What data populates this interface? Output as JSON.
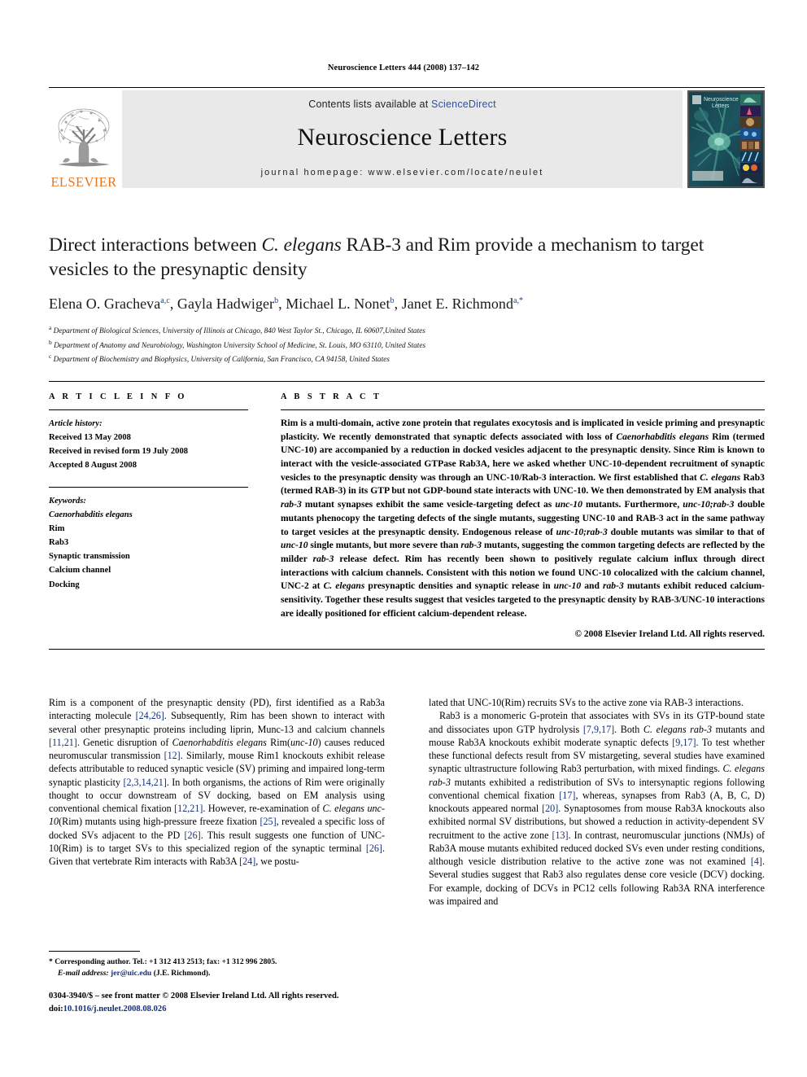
{
  "running_head": "Neuroscience Letters 444 (2008) 137–142",
  "masthead": {
    "contents_prefix": "Contents lists available at ",
    "sciencedirect": "ScienceDirect",
    "journal_name": "Neuroscience Letters",
    "homepage": "journal homepage: www.elsevier.com/locate/neulet",
    "publisher": "ELSEVIER",
    "cover_title_line1": "Neuroscience",
    "cover_title_line2": "Letters"
  },
  "article": {
    "title_part1": "Direct interactions between ",
    "title_italic": "C. elegans",
    "title_part2": " RAB-3 and Rim provide a mechanism to target vesicles to the presynaptic density",
    "authors": [
      {
        "name": "Elena O. Gracheva",
        "sup": "a,c",
        "sep": ", "
      },
      {
        "name": "Gayla Hadwiger",
        "sup": "b",
        "sep": ", "
      },
      {
        "name": "Michael L. Nonet",
        "sup": "b",
        "sep": ", "
      },
      {
        "name": "Janet E. Richmond",
        "sup": "a,*",
        "sep": ""
      }
    ],
    "affiliations": [
      {
        "marker": "a",
        "text": "Department of Biological Sciences, University of Illinois at Chicago, 840 West Taylor St., Chicago, IL 60607,United States"
      },
      {
        "marker": "b",
        "text": "Department of Anatomy and Neurobiology, Washington University School of Medicine, St. Louis, MO 63110, United States"
      },
      {
        "marker": "c",
        "text": "Department of Biochemistry and Biophysics, University of California, San Francisco, CA 94158, United States"
      }
    ]
  },
  "article_info": {
    "heading": "A R T I C L E   I N F O",
    "history_label": "Article history:",
    "history": [
      "Received 13 May 2008",
      "Received in revised form 19 July 2008",
      "Accepted 8 August 2008"
    ],
    "keywords_label": "Keywords:",
    "keywords": [
      "Caenorhabditis elegans",
      "Rim",
      "Rab3",
      "Synaptic transmission",
      "Calcium channel",
      "Docking"
    ],
    "keywords_italic_index": 0
  },
  "abstract": {
    "heading": "A B S T R A C T",
    "copyright": "© 2008 Elsevier Ireland Ltd. All rights reserved.",
    "paragraphs": [
      "Rim is a multi-domain, active zone protein that regulates exocytosis and is implicated in vesicle priming and presynaptic plasticity. We recently demonstrated that synaptic defects associated with loss of Caenorhabditis elegans Rim (termed UNC-10) are accompanied by a reduction in docked vesicles adjacent to the presynaptic density. Since Rim is known to interact with the vesicle-associated GTPase Rab3A, here we asked whether UNC-10-dependent recruitment of synaptic vesicles to the presynaptic density was through an UNC-10/Rab-3 interaction. We first established that C. elegans Rab3 (termed RAB-3) in its GTP but not GDP-bound state interacts with UNC-10. We then demonstrated by EM analysis that rab-3 mutant synapses exhibit the same vesicle-targeting defect as unc-10 mutants. Furthermore, unc-10;rab-3 double mutants phenocopy the targeting defects of the single mutants, suggesting UNC-10 and RAB-3 act in the same pathway to target vesicles at the presynaptic density. Endogenous release of unc-10;rab-3 double mutants was similar to that of unc-10 single mutants, but more severe than rab-3 mutants, suggesting the common targeting defects are reflected by the milder rab-3 release defect. Rim has recently been shown to positively regulate calcium influx through direct interactions with calcium channels. Consistent with this notion we found UNC-10 colocalized with the calcium channel, UNC-2 at C. elegans presynaptic densities and synaptic release in unc-10 and rab-3 mutants exhibit reduced calcium-sensitivity. Together these results suggest that vesicles targeted to the presynaptic density by RAB-3/UNC-10 interactions are ideally positioned for efficient calcium-dependent release."
    ]
  },
  "body": {
    "left_column": [
      "Rim is a component of the presynaptic density (PD), first identified as a Rab3a interacting molecule [24,26]. Subsequently, Rim has been shown to interact with several other presynaptic proteins including liprin, Munc-13 and calcium channels [11,21]. Genetic disruption of Caenorhabditis elegans Rim(unc-10) causes reduced neuromuscular transmission [12]. Similarly, mouse Rim1 knockouts exhibit release defects attributable to reduced synaptic vesicle (SV) priming and impaired long-term synaptic plasticity [2,3,14,21]. In both organisms, the actions of Rim were originally thought to occur downstream of SV docking, based on EM analysis using conventional chemical fixation [12,21]. However, re-examination of C. elegans unc-10(Rim) mutants using high-pressure freeze fixation [25], revealed a specific loss of docked SVs adjacent to the PD [26]. This result suggests one function of UNC-10(Rim) is to target SVs to this specialized region of the synaptic terminal [26]. Given that vertebrate Rim interacts with Rab3A [24], we postu-"
    ],
    "right_column": [
      "lated that UNC-10(Rim) recruits SVs to the active zone via RAB-3 interactions.",
      "Rab3 is a monomeric G-protein that associates with SVs in its GTP-bound state and dissociates upon GTP hydrolysis [7,9,17]. Both C. elegans rab-3 mutants and mouse Rab3A knockouts exhibit moderate synaptic defects [9,17]. To test whether these functional defects result from SV mistargeting, several studies have examined synaptic ultrastructure following Rab3 perturbation, with mixed findings. C. elegans rab-3 mutants exhibited a redistribution of SVs to intersynaptic regions following conventional chemical fixation [17], whereas, synapses from Rab3 (A, B, C, D) knockouts appeared normal [20]. Synaptosomes from mouse Rab3A knockouts also exhibited normal SV distributions, but showed a reduction in activity-dependent SV recruitment to the active zone [13]. In contrast, neuromuscular junctions (NMJs) of Rab3A mouse mutants exhibited reduced docked SVs even under resting conditions, although vesicle distribution relative to the active zone was not examined [4]. Several studies suggest that Rab3 also regulates dense core vesicle (DCV) docking. For example, docking of DCVs in PC12 cells following Rab3A RNA interference was impaired and"
    ]
  },
  "footnote": {
    "marker": "*",
    "line1": "Corresponding author. Tel.: +1 312 413 2513; fax: +1 312 996 2805.",
    "email_label": "E-mail address:",
    "email": "jer@uic.edu",
    "email_suffix": "(J.E. Richmond)."
  },
  "footer": {
    "issn_line": "0304-3940/$ – see front matter © 2008 Elsevier Ireland Ltd. All rights reserved.",
    "doi_label": "doi:",
    "doi_value": "10.1016/j.neulet.2008.08.026"
  },
  "colors": {
    "elsevier_orange": "#E87722",
    "link_blue": "#15307d",
    "sciencedirect_blue": "#2b4fb3",
    "band_gray": "#e9e9e9"
  }
}
